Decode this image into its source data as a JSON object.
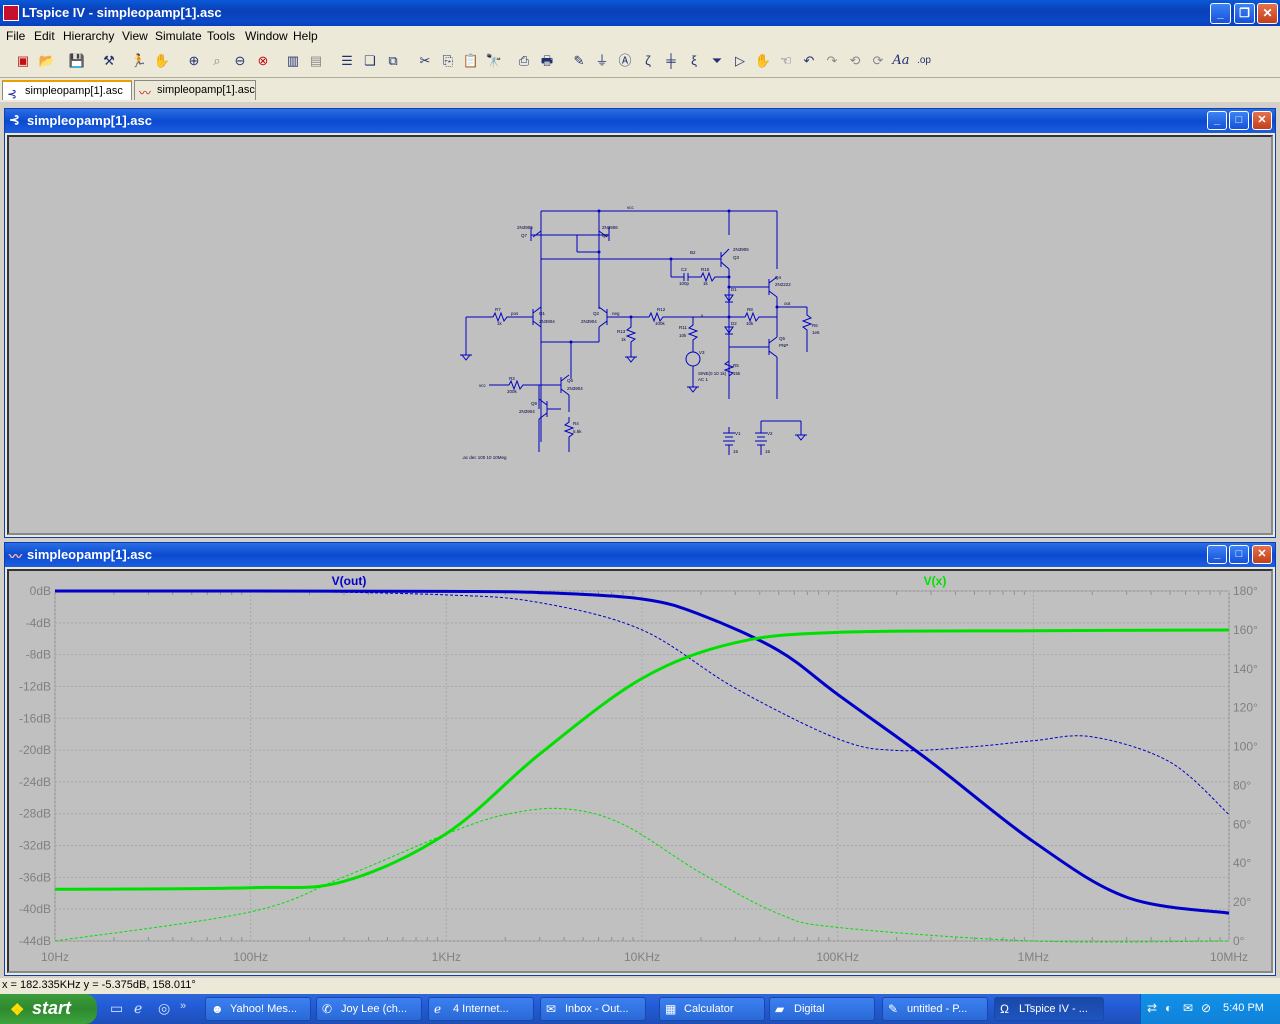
{
  "window": {
    "title": "LTspice IV - simpleopamp[1].asc"
  },
  "menu": [
    "File",
    "Edit",
    "Hierarchy",
    "View",
    "Simulate",
    "Tools",
    "Window",
    "Help"
  ],
  "tabs": [
    {
      "label": "simpleopamp[1].asc",
      "icon": "schematic-icon",
      "active": true
    },
    {
      "label": "simpleopamp[1].asc",
      "icon": "waveform-icon",
      "active": false
    }
  ],
  "schematic_window": {
    "title": "simpleopamp[1].asc",
    "labels": {
      "vcc_top": "vcc",
      "q7_model": "2N3906",
      "q7": "Q7",
      "q8_model": "2N3906",
      "q8": "Q8",
      "q3_model": "2N3906",
      "q3": "Q3",
      "q4_model": "2N2222",
      "q4": "Q4",
      "q1": "Q1",
      "q1_model": "2N3904",
      "q2": "Q2",
      "q2_model": "2N3904",
      "q5": "Q5",
      "q5_model": "PNP",
      "q6": "Q6",
      "q6_model": "2N3904",
      "q9": "Q9",
      "q9_model": "2N3904",
      "r7": "R7",
      "r7_val": "1k",
      "pos": "pos",
      "neg": "neg",
      "r12": "R12",
      "r12_val": "100k",
      "r13": "R13",
      "r13_val": "1k",
      "r11": "R11",
      "r11_val": "10k",
      "c2": "C2",
      "c2_val": "100p",
      "r10": "R10",
      "r10_val": "1k",
      "b2": "B2",
      "d1": "D1",
      "d2": "D2",
      "r8": "R8",
      "r8_val": "10k",
      "r5": "R5",
      "r5_val": "15k",
      "r6": "R6",
      "r6_val": "1e6",
      "out": "out",
      "x": "x",
      "v3": "V3",
      "v3_val": "SINE(0 10 1k)",
      "v3_ac": "AC 1",
      "r3": "R3",
      "r3_val": "200k",
      "r4": "R4",
      "r4_val": "5.6k",
      "vcc_left": "vcc",
      "v1": "V1",
      "v1_val": "15",
      "v2": "V2",
      "v2_val": "15",
      "directive": ".ac dec 100 10 10Meg"
    }
  },
  "plot_window": {
    "title": "simpleopamp[1].asc"
  },
  "chart_data": {
    "type": "line",
    "title": "",
    "x_scale": "log",
    "x_range_hz": [
      10,
      10000000
    ],
    "x_ticks": [
      "10Hz",
      "100Hz",
      "1KHz",
      "10KHz",
      "100KHz",
      "1MHz",
      "10MHz"
    ],
    "y_left_label_unit": "dB",
    "y_left_range": [
      -44,
      0
    ],
    "y_left_ticks": [
      "0dB",
      "-4dB",
      "-8dB",
      "-12dB",
      "-16dB",
      "-20dB",
      "-24dB",
      "-28dB",
      "-32dB",
      "-36dB",
      "-40dB",
      "-44dB"
    ],
    "y_right_range": [
      0,
      180
    ],
    "y_right_ticks": [
      "180°",
      "160°",
      "140°",
      "120°",
      "100°",
      "80°",
      "60°",
      "40°",
      "20°",
      "0°"
    ],
    "grid": true,
    "series": [
      {
        "name": "V(out)",
        "color": "#0000c8",
        "quantity": "magnitude",
        "axis": "left",
        "x": [
          10,
          100,
          1000,
          3000,
          10000,
          20000,
          50000,
          100000,
          300000,
          1000000,
          3000000,
          10000000
        ],
        "y": [
          0,
          0,
          -0.05,
          -0.2,
          -1.0,
          -3.0,
          -7.5,
          -13.0,
          -21.5,
          -31.5,
          -38.5,
          -40.5
        ]
      },
      {
        "name": "V(out)",
        "color": "#0000c8",
        "quantity": "phase",
        "axis": "right",
        "x": [
          10,
          100,
          1000,
          3000,
          10000,
          30000,
          100000,
          200000,
          500000,
          1000000,
          2000000,
          5000000,
          10000000
        ],
        "y": [
          180,
          180,
          178,
          174,
          160,
          130,
          104,
          98,
          100,
          103,
          105,
          92,
          65
        ]
      },
      {
        "name": "V(x)",
        "color": "#00e000",
        "quantity": "magnitude",
        "axis": "left",
        "x": [
          10,
          100,
          300,
          1000,
          3000,
          10000,
          30000,
          100000,
          1000000,
          10000000
        ],
        "y": [
          -37.5,
          -37.3,
          -36.5,
          -30.5,
          -20.5,
          -11.0,
          -6.5,
          -5.2,
          -5.0,
          -4.9
        ]
      },
      {
        "name": "V(x)",
        "color": "#00e000",
        "quantity": "phase",
        "axis": "right",
        "x": [
          10,
          100,
          300,
          1000,
          2000,
          4000,
          8000,
          20000,
          50000,
          100000,
          1000000,
          10000000
        ],
        "y": [
          0,
          15,
          33,
          55,
          65,
          68,
          60,
          35,
          14,
          7,
          0,
          0
        ]
      }
    ]
  },
  "status": {
    "cursor_text": "x = 182.335KHz    y = -5.375dB, 158.011°"
  },
  "taskbar": {
    "start": "start",
    "tasks": [
      {
        "label": "Yahoo! Mes...",
        "icon": "smiley-icon"
      },
      {
        "label": "Joy Lee (ch...",
        "icon": "chat-icon"
      },
      {
        "label": "4 Internet...",
        "icon": "ie-icon"
      },
      {
        "label": "Inbox - Out...",
        "icon": "mail-icon"
      },
      {
        "label": "Calculator",
        "icon": "calc-icon"
      },
      {
        "label": "Digital",
        "icon": "folder-icon"
      },
      {
        "label": "untitled - P...",
        "icon": "paint-icon"
      },
      {
        "label": "LTspice IV - ...",
        "icon": "ltspice-icon",
        "active": true
      }
    ],
    "clock": "5:40 PM"
  }
}
